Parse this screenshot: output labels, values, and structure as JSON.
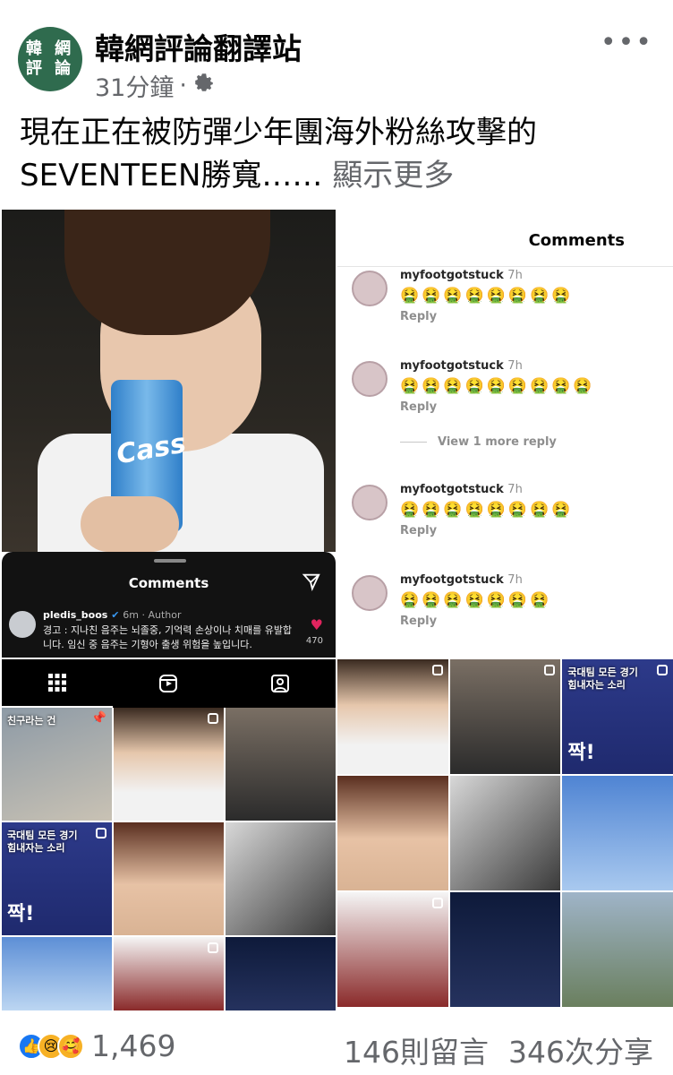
{
  "post": {
    "avatar_text": [
      "韓 網",
      "評 論"
    ],
    "page_name": "韓網評論翻譯站",
    "time": "31分鐘",
    "audience_icon": "gear-icon",
    "text": "現在正在被防彈少年團海外粉絲攻擊的SEVENTEEN勝寬……",
    "see_more": "顯示更多",
    "more_icon": "•••"
  },
  "photo_panel": {
    "can_text": "Cass",
    "dark_comments": {
      "title": "Comments",
      "user": "pledis_boos",
      "time": "6m · Author",
      "text": "경고 : 지나친 음주는 뇌졸중, 기억력 손상이나 치매를 유발합니다. 임신 중 음주는 기형아 출생 위험을 높입니다.",
      "like_count": "470"
    }
  },
  "comments_panel": {
    "title": "Comments",
    "items": [
      {
        "user": "myfootgotstuck",
        "time": "7h",
        "emojis": "🤮🤮🤮🤮🤮🤮🤮🤮",
        "reply": "Reply"
      },
      {
        "user": "myfootgotstuck",
        "time": "7h",
        "emojis": "🤮🤮🤮🤮🤮🤮🤮🤮🤮",
        "reply": "Reply"
      },
      {
        "user": "myfootgotstuck",
        "time": "7h",
        "emojis": "🤮🤮🤮🤮🤮🤮🤮🤮",
        "reply": "Reply"
      },
      {
        "user": "myfootgotstuck",
        "time": "7h",
        "emojis": "🤮🤮🤮🤮🤮🤮🤮",
        "reply": "Reply"
      }
    ],
    "view_more": "View 1 more reply"
  },
  "profile_tabs": [
    "grid-icon",
    "reels-icon",
    "tagged-icon"
  ],
  "grid_captions": {
    "sign_left": "친구라는 건",
    "banner_left": "국대팀 모든 경기\n힘내자는 소리",
    "banner_left_big": "짝!",
    "banner_right": "국대팀 모든 경기\n힘내자는 소리",
    "banner_right_big": "짝!"
  },
  "footer": {
    "reaction_count": "1,469",
    "comments": "146則留言",
    "shares": "346次分享"
  }
}
